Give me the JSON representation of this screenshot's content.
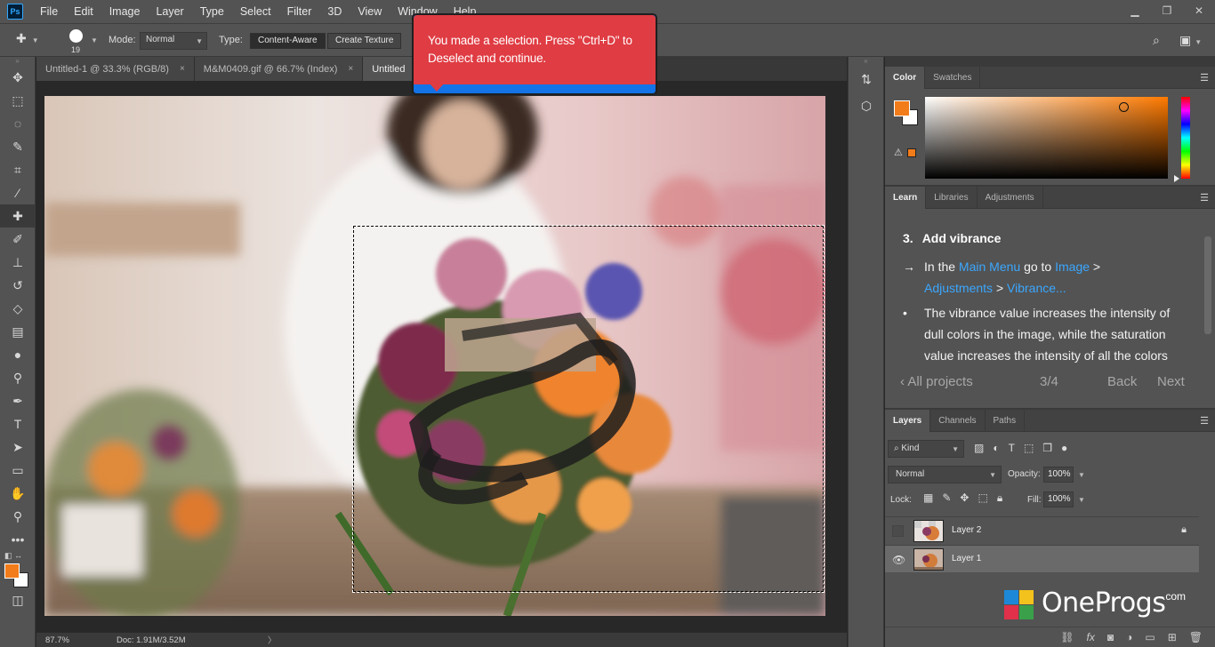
{
  "app": {
    "logo": "Ps"
  },
  "menu": [
    "File",
    "Edit",
    "Image",
    "Layer",
    "Type",
    "Select",
    "Filter",
    "3D",
    "View",
    "Window",
    "Help"
  ],
  "options": {
    "brush_size": "19",
    "mode_label": "Mode:",
    "mode_value": "Normal",
    "type_label": "Type:",
    "type_buttons": [
      "Content-Aware",
      "Create Texture"
    ]
  },
  "tabs": [
    {
      "label": "Untitled-1 @ 33.3% (RGB/8)",
      "close": "×"
    },
    {
      "label": "M&M0409.gif @ 66.7% (Index)",
      "close": "×"
    },
    {
      "label": "Untitled",
      "close": ""
    }
  ],
  "tooltip": {
    "text": "You made a selection. Press \"Ctrl+D\" to Deselect and continue."
  },
  "status": {
    "zoom": "87.7%",
    "doc": "Doc: 1.91M/3.52M",
    "arrow": "〉"
  },
  "color_panel": {
    "tabs": [
      "Color",
      "Swatches"
    ],
    "fg_color": "#f37c1a",
    "bg_color": "#ffffff"
  },
  "learn_panel": {
    "tabs": [
      "Learn",
      "Libraries",
      "Adjustments"
    ],
    "step_number": "3.",
    "step_title": "Add vibrance",
    "instruction": {
      "arrow": "→",
      "prefix": "In the",
      "main_menu": "Main Menu",
      "goto": "go to",
      "image": "Image",
      "gt1": ">",
      "adjustments": "Adjustments",
      "gt2": ">",
      "vibrance": "Vibrance..."
    },
    "bullet": "•",
    "bullet_text": [
      "The vibrance value increases the intensity of",
      "dull colors in the image, while the saturation",
      "value increases the intensity of all the colors"
    ],
    "nav": {
      "all_projects": "‹ All projects",
      "progress": "3/4",
      "back": "Back",
      "next": "Next"
    }
  },
  "layers_panel": {
    "tabs": [
      "Layers",
      "Channels",
      "Paths"
    ],
    "kind": "Kind",
    "blend_mode": "Normal",
    "opacity_label": "Opacity:",
    "opacity_value": "100%",
    "lock_label": "Lock:",
    "fill_label": "Fill:",
    "fill_value": "100%",
    "layers": [
      {
        "name": "Layer 2",
        "visible": false,
        "locked": true,
        "selected": false
      },
      {
        "name": "Layer 1",
        "visible": true,
        "locked": false,
        "selected": true
      }
    ]
  },
  "watermark": {
    "text": "OneProgs",
    "suffix": ".com"
  }
}
